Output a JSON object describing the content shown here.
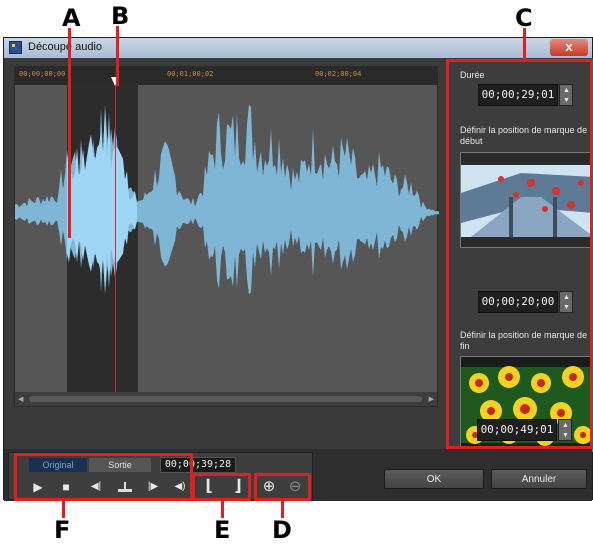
{
  "window": {
    "title": "Découpe audio",
    "close_label": "x"
  },
  "annotations": {
    "A": "A",
    "B": "B",
    "C": "C",
    "D": "D",
    "E": "E",
    "F": "F"
  },
  "timeline": {
    "ruler_ticks": [
      "00;00;00;00",
      "00;01;00;02",
      "00;02;00;04"
    ]
  },
  "side_panel": {
    "duration_label": "Durée",
    "duration_value": "00;00;29;01",
    "mark_in_label": "Définir la position de marque de début",
    "mark_in_value": "00;00;20;00",
    "mark_out_label": "Définir la position de marque de fin",
    "mark_out_value": "00;00;49;01"
  },
  "controls": {
    "tab_original": "Original",
    "tab_output": "Sortie",
    "current_time": "00;00;39;28",
    "play_glyph": "▶",
    "stop_glyph": "■",
    "prev_frame_glyph": "◀|",
    "next_frame_glyph": "|▶",
    "volume_glyph": "◀)",
    "mark_in_glyph": "⌊",
    "mark_out_glyph": "⌋",
    "zoom_in_glyph": "⊕",
    "zoom_out_glyph": "⊖"
  },
  "buttons": {
    "ok": "OK",
    "cancel": "Annuler"
  },
  "colors": {
    "accent_red": "#e0201c",
    "waveform": "#7fb6d6",
    "waveform_selected": "#9fd6f4",
    "ruler_text": "#c5912b"
  },
  "icons": {
    "app": "app-icon",
    "play": "play-icon",
    "stop": "stop-icon",
    "prev_frame": "previous-frame-icon",
    "next_frame": "next-frame-icon",
    "volume": "volume-icon",
    "zoom_in": "zoom-in-icon",
    "zoom_out": "zoom-out-icon"
  }
}
